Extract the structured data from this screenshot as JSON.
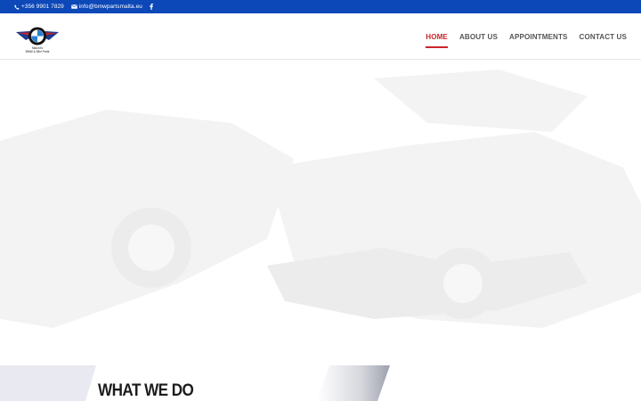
{
  "topbar": {
    "phone": "+356 9901 7829",
    "email": "info@bmwpartsmalta.eu",
    "icons": [
      "phone-icon",
      "envelope-icon",
      "facebook-icon"
    ],
    "background": "#0d48b8"
  },
  "logo": {
    "line1": "Maurid's",
    "line2": "BMW & Mini Parts"
  },
  "nav": {
    "items": [
      {
        "label": "HOME",
        "active": true
      },
      {
        "label": "ABOUT US",
        "active": false
      },
      {
        "label": "APPOINTMENTS",
        "active": false
      },
      {
        "label": "CONTACT US",
        "active": false
      }
    ],
    "accent_color": "#c8262b"
  },
  "section": {
    "title": "WHAT WE DO"
  }
}
